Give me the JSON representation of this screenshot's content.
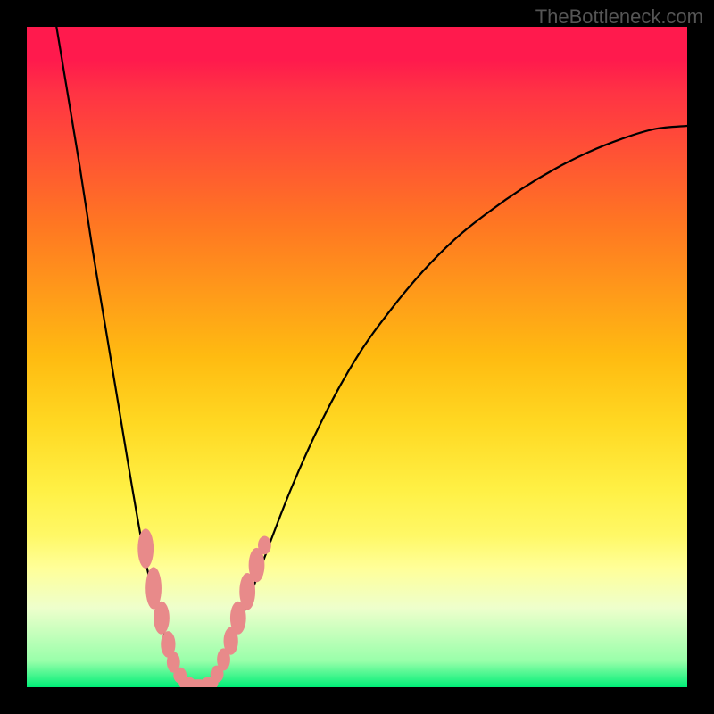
{
  "watermark": "TheBottleneck.com",
  "colors": {
    "frame": "#000000",
    "watermark": "#555555",
    "curve": "#000000",
    "bead": "#e88a8a",
    "gradient_top": "#ff1a4d",
    "gradient_bottom": "#00ee77"
  },
  "chart_data": {
    "type": "line",
    "title": "",
    "xlabel": "",
    "ylabel": "",
    "xlim": [
      0,
      100
    ],
    "ylim": [
      0,
      100
    ],
    "grid": false,
    "notes": "Bottleneck-style valley curve on a rainbow gradient; x is an unlabeled parameter axis, y is an unlabeled bottleneck/score axis. No numeric tick labels are rendered. Values below are estimated from pixel positions within the 740×740 plot rectangle (x/y expressed as 0–100 percent of axis range).",
    "series": [
      {
        "name": "left-descending-branch",
        "x": [
          4.5,
          6,
          8,
          10,
          12,
          14,
          16,
          18,
          20,
          21.5,
          23,
          24
        ],
        "y": [
          100,
          91,
          79,
          66,
          54,
          42,
          30,
          19,
          11,
          6,
          2.5,
          0.5
        ]
      },
      {
        "name": "valley-floor",
        "x": [
          24,
          25,
          26,
          27,
          28
        ],
        "y": [
          0.5,
          0,
          0,
          0,
          0.5
        ]
      },
      {
        "name": "right-ascending-branch",
        "x": [
          28,
          30,
          32,
          35,
          40,
          45,
          50,
          55,
          60,
          65,
          70,
          75,
          80,
          85,
          90,
          95,
          100
        ],
        "y": [
          0.5,
          4,
          9,
          17,
          30,
          41,
          50,
          57,
          63,
          68,
          72,
          75.5,
          78.5,
          81,
          83,
          84.5,
          85
        ]
      }
    ],
    "markers": {
      "name": "bead-cluster",
      "description": "Salmon rounded markers clustered near the valley along both branches",
      "points": [
        {
          "x": 18.0,
          "y": 21.0,
          "rx": 1.2,
          "ry": 3.0
        },
        {
          "x": 19.2,
          "y": 15.0,
          "rx": 1.2,
          "ry": 3.2
        },
        {
          "x": 20.4,
          "y": 10.5,
          "rx": 1.2,
          "ry": 2.5
        },
        {
          "x": 21.4,
          "y": 6.5,
          "rx": 1.1,
          "ry": 2.0
        },
        {
          "x": 22.2,
          "y": 3.8,
          "rx": 1.0,
          "ry": 1.6
        },
        {
          "x": 23.2,
          "y": 1.8,
          "rx": 1.0,
          "ry": 1.2
        },
        {
          "x": 24.3,
          "y": 0.6,
          "rx": 1.3,
          "ry": 1.0
        },
        {
          "x": 26.0,
          "y": 0.2,
          "rx": 2.0,
          "ry": 1.0
        },
        {
          "x": 27.7,
          "y": 0.6,
          "rx": 1.3,
          "ry": 1.0
        },
        {
          "x": 28.8,
          "y": 2.0,
          "rx": 1.0,
          "ry": 1.3
        },
        {
          "x": 29.8,
          "y": 4.2,
          "rx": 1.0,
          "ry": 1.7
        },
        {
          "x": 30.9,
          "y": 7.0,
          "rx": 1.1,
          "ry": 2.1
        },
        {
          "x": 32.0,
          "y": 10.5,
          "rx": 1.2,
          "ry": 2.5
        },
        {
          "x": 33.4,
          "y": 14.5,
          "rx": 1.2,
          "ry": 2.8
        },
        {
          "x": 34.8,
          "y": 18.5,
          "rx": 1.2,
          "ry": 2.6
        },
        {
          "x": 36.0,
          "y": 21.5,
          "rx": 1.0,
          "ry": 1.4
        }
      ]
    }
  }
}
